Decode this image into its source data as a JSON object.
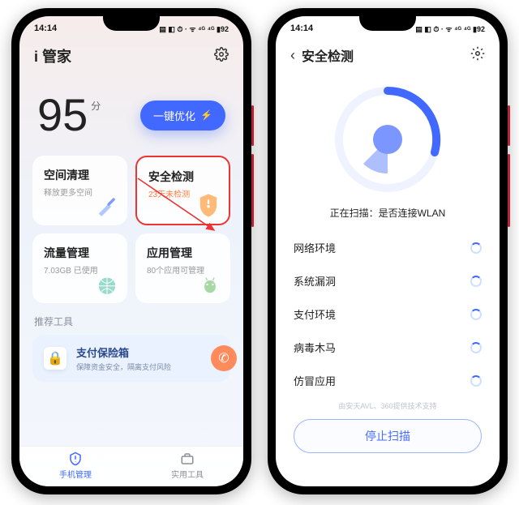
{
  "status_time": "14:14",
  "status_icons": "▤ ◧ ⏱ · ᯤ ⁴ᴳ ⁴ᴳ ▮92",
  "p1": {
    "title": "i 管家",
    "gear": "settings-icon",
    "score": "95",
    "unit": "分",
    "optimize": "一键优化",
    "cards": [
      {
        "t": "空间清理",
        "s": "释放更多空间",
        "ic": "broom"
      },
      {
        "t": "安全检测",
        "s": "23天未检测",
        "ic": "shield",
        "warn": true,
        "hl": true
      },
      {
        "t": "流量管理",
        "s": "7.03GB 已使用",
        "ic": "globe"
      },
      {
        "t": "应用管理",
        "s": "80个应用可管理",
        "ic": "android"
      }
    ],
    "rec_hdr": "推荐工具",
    "promo": {
      "t": "支付保险箱",
      "s": "保障资金安全，隔离支付风险"
    },
    "tabs": [
      {
        "l": "手机管理",
        "ic": "shield"
      },
      {
        "l": "实用工具",
        "ic": "toolbox"
      }
    ]
  },
  "p2": {
    "title": "安全检测",
    "scan_label": "正在扫描：是否连接WLAN",
    "items": [
      "网络环境",
      "系统漏洞",
      "支付环境",
      "病毒木马",
      "仿冒应用"
    ],
    "credit": "由安天AVL、360提供技术支持",
    "stop": "停止扫描"
  }
}
